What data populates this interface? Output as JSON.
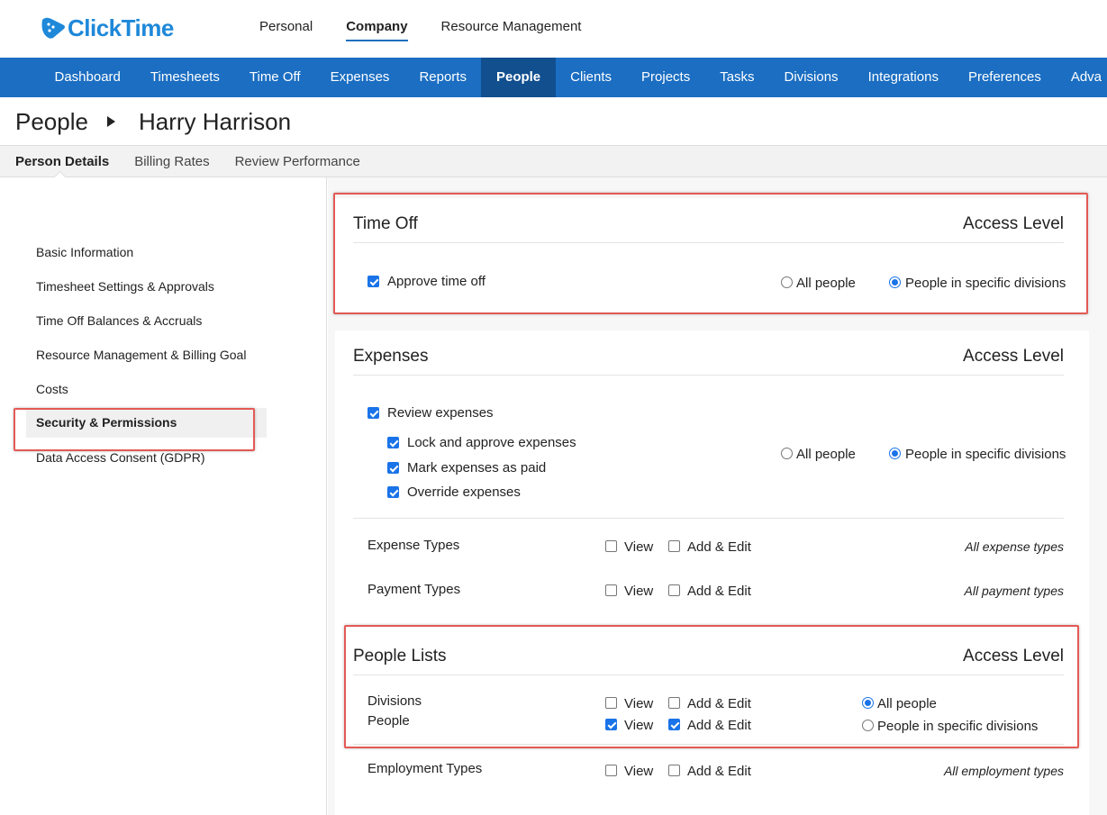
{
  "app": {
    "logo_text": "ClickTime"
  },
  "top_nav": [
    "Personal",
    "Company",
    "Resource Management"
  ],
  "main_nav": [
    "Dashboard",
    "Timesheets",
    "Time Off",
    "Expenses",
    "Reports",
    "People",
    "Clients",
    "Projects",
    "Tasks",
    "Divisions",
    "Integrations",
    "Preferences",
    "Adva"
  ],
  "title": {
    "crumb": "People",
    "name": "Harry Harrison"
  },
  "subtabs": [
    "Person Details",
    "Billing Rates",
    "Review Performance"
  ],
  "sidebar": [
    "Basic Information",
    "Timesheet Settings & Approvals",
    "Time Off Balances & Accruals",
    "Resource Management & Billing Goal",
    "Costs",
    "Security & Permissions",
    "Data Access Consent (GDPR)"
  ],
  "colors": {
    "brand": "#1e88d9",
    "nav": "#1b6ec2",
    "nav_active": "#114f8f",
    "highlight": "#e35a55",
    "check": "#1a73e8"
  },
  "common": {
    "access_level": "Access Level",
    "all_people": "All people",
    "specific_divisions": "People in specific divisions",
    "view": "View",
    "add_edit": "Add & Edit"
  },
  "time_off": {
    "title": "Time Off",
    "approve": "Approve time off"
  },
  "expenses": {
    "title": "Expenses",
    "review": "Review expenses",
    "lock": "Lock and approve expenses",
    "mark_paid": "Mark expenses as paid",
    "override": "Override expenses",
    "expense_types": "Expense Types",
    "expense_types_scope": "All expense types",
    "payment_types": "Payment Types",
    "payment_types_scope": "All payment types"
  },
  "people_lists": {
    "title": "People Lists",
    "divisions": "Divisions",
    "people": "People",
    "employment_types": "Employment Types",
    "employment_types_scope": "All employment types"
  }
}
